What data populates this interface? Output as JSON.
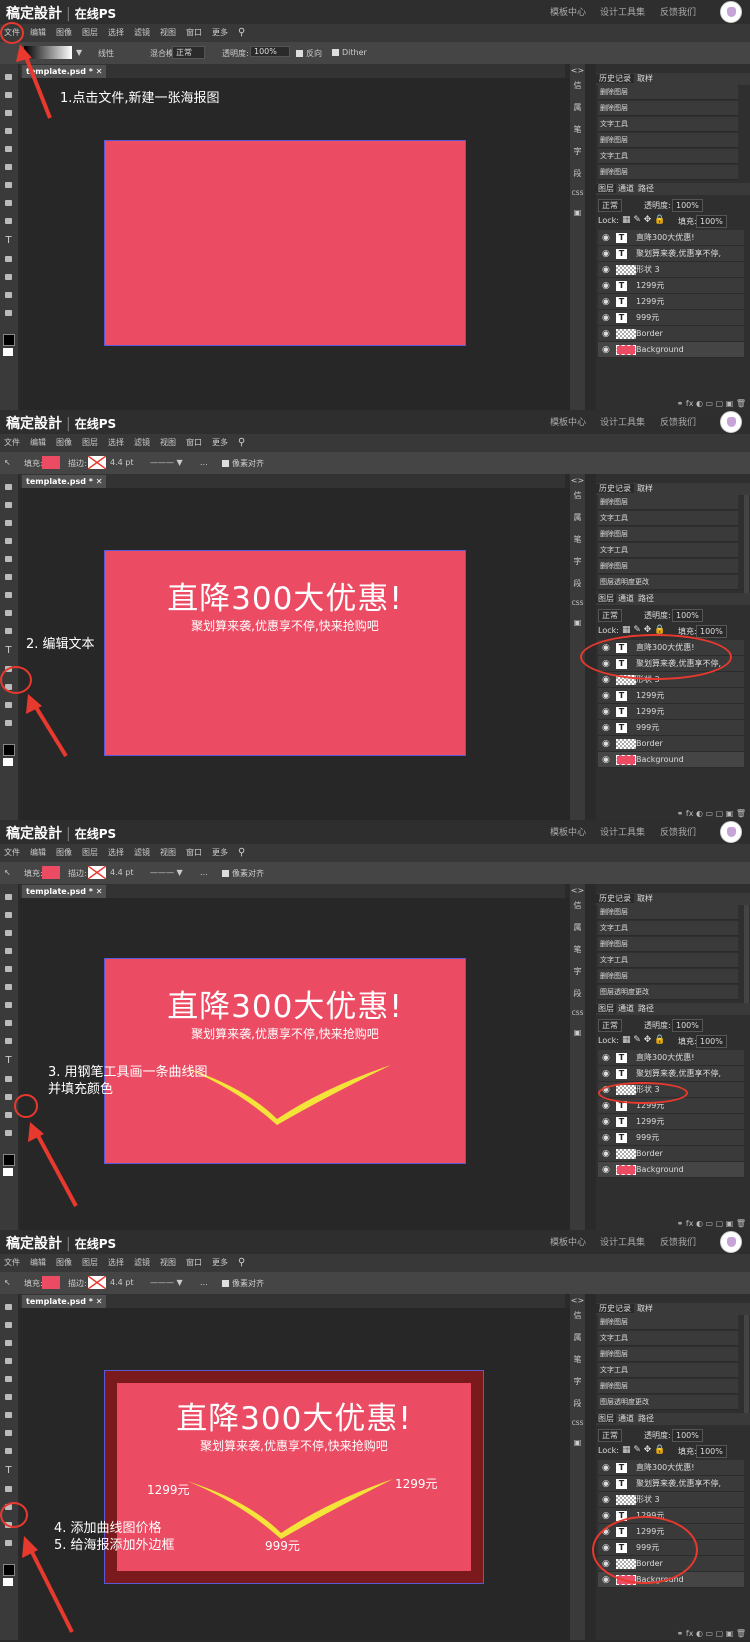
{
  "brand": {
    "name": "稿定設計",
    "sub": "在线PS"
  },
  "toplinks": [
    "模板中心",
    "设计工具集",
    "反馈我们"
  ],
  "menu": [
    "文件",
    "编辑",
    "图像",
    "图层",
    "选择",
    "滤镜",
    "视图",
    "窗口",
    "更多"
  ],
  "options1": {
    "mode_label": "线性",
    "blend_label": "混合模式:",
    "blend_value": "正常",
    "opacity_label": "透明度:",
    "opacity_value": "100%",
    "reverse": "反向",
    "dither": "Dither"
  },
  "options2": {
    "fill_label": "填充:",
    "stroke_label": "描边:",
    "stroke_size": "4.4 pt",
    "more": "...",
    "align": "像素对齐"
  },
  "doc_tab": "template.psd *",
  "side_narrow": [
    "信",
    "属",
    "笔",
    "字",
    "段",
    "CSS"
  ],
  "right_tabs": [
    "历史记录",
    "取样"
  ],
  "layer_tabs": [
    "图层",
    "通道",
    "路径"
  ],
  "blend_mode": "正常",
  "opacity_label": "透明度:",
  "opacity_value": "100%",
  "lock_label": "Lock:",
  "fill_label": "填充:",
  "fill_value": "100%",
  "history1": [
    "删除图层",
    "删除图层",
    "文字工具",
    "删除图层",
    "文字工具",
    "删除图层"
  ],
  "history2": [
    "删除图层",
    "文字工具",
    "删除图层",
    "文字工具",
    "删除图层",
    "图层透明度更改"
  ],
  "layers": [
    "直降300大优惠!",
    "聚划算来袭,优惠享不停,",
    "形状 3",
    "1299元",
    "1299元",
    "999元",
    "Border",
    "Background"
  ],
  "poster": {
    "title": "直降300大优惠!",
    "subtitle": "聚划算来袭,优惠享不停,快来抢购吧",
    "price_left": "1299元",
    "price_right": "1299元",
    "price_center": "999元"
  },
  "annotations": {
    "step1": "1.点击文件,新建一张海报图",
    "step2": "2. 编辑文本",
    "step3_line1": "3. 用钢笔工具画一条曲线图",
    "step3_line2": "并填充颜色",
    "step4": "4. 添加曲线图价格",
    "step5": "5. 给海报添加外边框"
  },
  "colors": {
    "poster": "#ec4b64",
    "border": "#7b1a1c",
    "annotation": "#e8392f",
    "curve": "#f4e43a"
  }
}
